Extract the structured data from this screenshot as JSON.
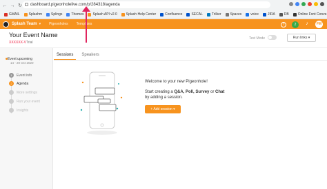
{
  "browser": {
    "url": "dashboard.pigeonholelive.com/p/284318/agenda",
    "bookmarks": [
      {
        "label": "GMAIL",
        "color": "#d93025"
      },
      {
        "label": "Splashm",
        "color": "#f7931e"
      },
      {
        "label": "Splings",
        "color": "#4285f4"
      },
      {
        "label": "Themes",
        "color": "#4285f4"
      },
      {
        "label": "Splash API v2.0",
        "color": "#f7931e"
      },
      {
        "label": "Splash Help Center",
        "color": "#f7931e"
      },
      {
        "label": "Confluence",
        "color": "#0052cc"
      },
      {
        "label": "SECAL",
        "color": "#0052cc"
      },
      {
        "label": "Trilker",
        "color": "#0079bf"
      },
      {
        "label": "Spaces",
        "color": "#777"
      },
      {
        "label": "voice",
        "color": "#1a73e8"
      },
      {
        "label": "JIRA",
        "color": "#0052cc"
      },
      {
        "label": "DB",
        "color": "#555"
      },
      {
        "label": "Online Font Conve...",
        "color": "#333"
      },
      {
        "label": "Asana",
        "color": "#f06a6a"
      }
    ]
  },
  "topbar": {
    "team": "Splash Team",
    "links": [
      "Pigeonholes",
      "Templates"
    ],
    "notif_count": "2",
    "avatar": "FM"
  },
  "event": {
    "name": "Your Event Name",
    "edit": "Edit",
    "code": "XXXXXX-V",
    "plan": "Trial",
    "test_mode": "Test Mode",
    "run_links": "Run links"
  },
  "sidebar": {
    "status": "Event upcoming",
    "dates": "14 - 20 Oct 2020",
    "steps": [
      {
        "n": "1",
        "label": "Event info",
        "state": "done"
      },
      {
        "n": "2",
        "label": "Agenda",
        "state": "active"
      },
      {
        "n": "",
        "label": "More settings",
        "state": "dim"
      },
      {
        "n": "",
        "label": "Run your event",
        "state": "dim"
      },
      {
        "n": "",
        "label": "Insights",
        "state": "dim"
      }
    ]
  },
  "tabs": [
    "Sessions",
    "Speakers"
  ],
  "empty": {
    "welcome": "Welcome to your new Pigeonhole!",
    "line1_pre": "Start creating a ",
    "line1_bold": "Q&A, Poll, Survey",
    "line1_mid": " or ",
    "line1_bold2": "Chat",
    "line2": "by adding a session.",
    "button": "+ Add session"
  },
  "colors": {
    "accent": "#f7931e",
    "annotation": "#e0245e"
  }
}
